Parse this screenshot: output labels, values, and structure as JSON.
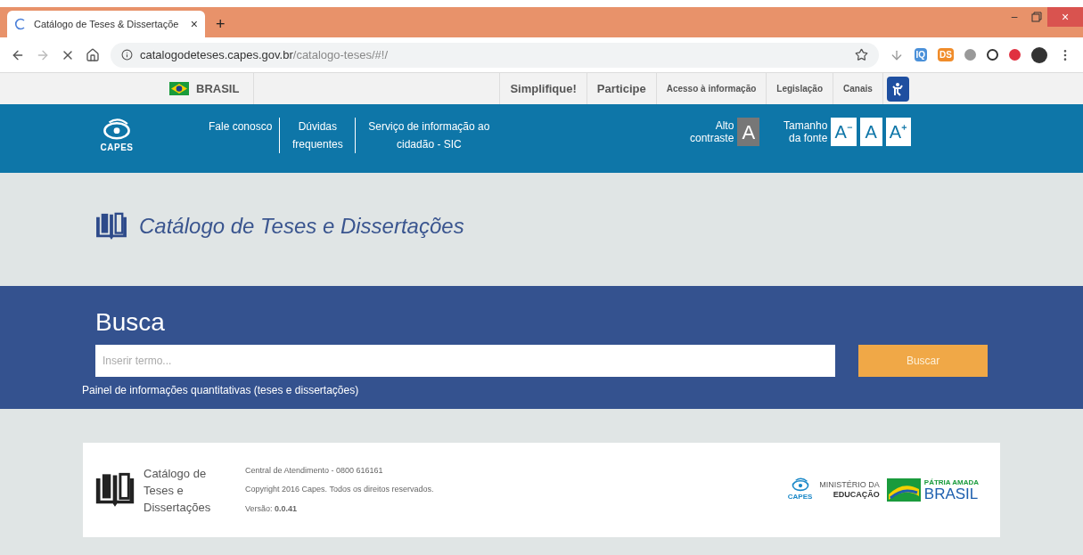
{
  "browser": {
    "tab": {
      "title": "Catálogo de Teses & Dissertaçõe",
      "close": "×"
    },
    "new_tab": "+",
    "window_buttons": {
      "minimize": "–",
      "close": "×"
    },
    "url": {
      "host": "catalogodeteses.capes.gov.br",
      "path": "/catalogo-teses/#!/"
    },
    "extensions": [
      {
        "kind": "text",
        "label": "IQ",
        "color": "#4a90d9"
      },
      {
        "kind": "text",
        "label": "DS",
        "color": "#f08c2a"
      }
    ]
  },
  "gov_bar": {
    "country": "BRASIL",
    "links": [
      {
        "label": "Simplifique!",
        "kind": "big"
      },
      {
        "label": "Participe",
        "kind": "big"
      },
      {
        "label": "Acesso à informação",
        "kind": "small"
      },
      {
        "label": "Legislação",
        "kind": "small"
      },
      {
        "label": "Canais",
        "kind": "small"
      }
    ]
  },
  "header": {
    "logo": "CAPES",
    "links": [
      {
        "label": "Fale conosco"
      },
      {
        "label": "Dúvidas frequentes"
      },
      {
        "label": "Serviço de informação ao cidadão - SIC"
      }
    ],
    "contrast": {
      "label": "Alto contraste",
      "button": "A"
    },
    "font_size": {
      "label": "Tamanho da fonte",
      "buttons": [
        "A⁻",
        "A",
        "A⁺"
      ]
    }
  },
  "title": "Catálogo de Teses e Dissertações",
  "search": {
    "heading": "Busca",
    "placeholder": "Inserir termo...",
    "button": "Buscar",
    "link": "Painel de informações quantitativas (teses e dissertações)"
  },
  "footer": {
    "brand": "Catálogo de Teses e Dissertações",
    "lines": [
      "Central de Atendimento - 0800 616161",
      "Copyright 2016 Capes. Todos os direitos reservados.",
      "Versão: **0.0.41**"
    ],
    "logos": {
      "capes": "CAPES",
      "ministry_top": "MINISTÉRIO DA",
      "ministry_bottom": "EDUCAÇÃO",
      "brasil_top": "PÁTRIA AMADA",
      "brasil": "BRASIL"
    }
  }
}
